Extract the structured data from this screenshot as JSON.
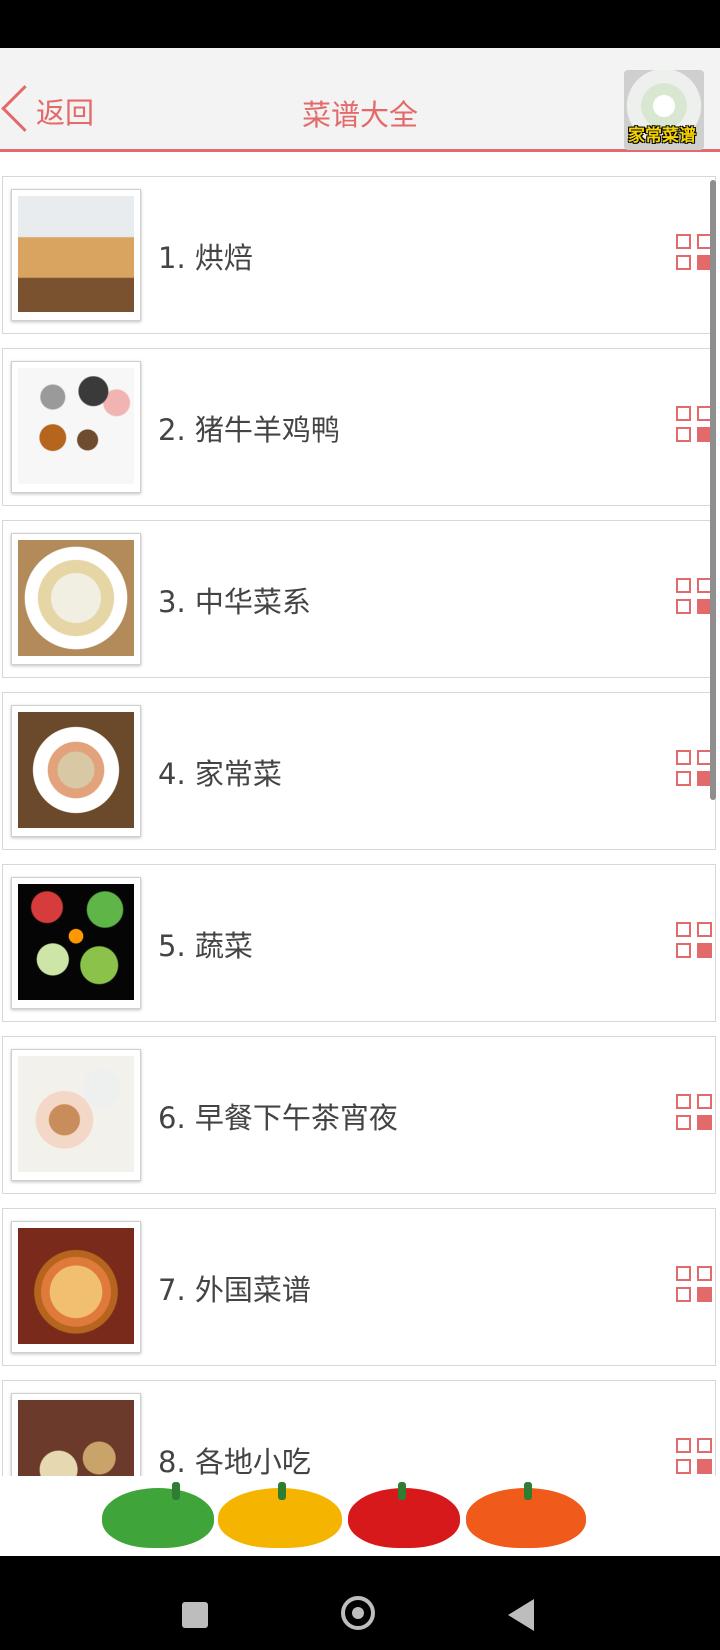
{
  "header": {
    "back_label": "返回",
    "title": "菜谱大全",
    "logo_text": "家常菜谱"
  },
  "colors": {
    "accent": "#e36a6a",
    "item_text": "#444444"
  },
  "list": {
    "items": [
      {
        "label": "1. 烘焙",
        "thumb": "bread"
      },
      {
        "label": "2. 猪牛羊鸡鸭",
        "thumb": "animals"
      },
      {
        "label": "3. 中华菜系",
        "thumb": "soup"
      },
      {
        "label": "4. 家常菜",
        "thumb": "stirfry"
      },
      {
        "label": "5. 蔬菜",
        "thumb": "vegetables"
      },
      {
        "label": "6. 早餐下午茶宵夜",
        "thumb": "coffee"
      },
      {
        "label": "7. 外国菜谱",
        "thumb": "pizza"
      },
      {
        "label": "8. 各地小吃",
        "thumb": "snacks"
      }
    ]
  },
  "icons": {
    "menu_icon": "grid-icon",
    "back_icon": "chevron-left-icon"
  }
}
